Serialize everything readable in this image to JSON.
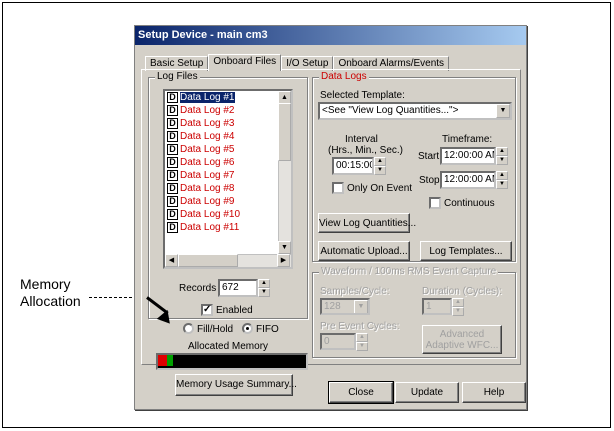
{
  "callout": {
    "line1": "Memory",
    "line2": "Allocation"
  },
  "dialog": {
    "title": "Setup Device - main cm3",
    "tabs": [
      "Basic Setup",
      "Onboard Files",
      "I/O Setup",
      "Onboard Alarms/Events"
    ],
    "active_tab": "Onboard Files"
  },
  "log_files": {
    "group_label": "Log Files",
    "items": [
      {
        "icon": "D",
        "label": "Data Log #1",
        "selected": true
      },
      {
        "icon": "D",
        "label": "Data Log #2"
      },
      {
        "icon": "D",
        "label": "Data Log #3"
      },
      {
        "icon": "D",
        "label": "Data Log #4"
      },
      {
        "icon": "D",
        "label": "Data Log #5"
      },
      {
        "icon": "D",
        "label": "Data Log #6"
      },
      {
        "icon": "D",
        "label": "Data Log #7"
      },
      {
        "icon": "D",
        "label": "Data Log #8"
      },
      {
        "icon": "D",
        "label": "Data Log #9"
      },
      {
        "icon": "D",
        "label": "Data Log #10"
      },
      {
        "icon": "D",
        "label": "Data Log #11"
      }
    ],
    "records_label": "Records",
    "records_value": "672",
    "enabled_label": "Enabled",
    "enabled_checked": true,
    "fill_hold_label": "Fill/Hold",
    "fifo_label": "FIFO",
    "mode_selected": "FIFO",
    "allocated_label": "Allocated Memory",
    "memory_summary_label": "Memory Usage Summary..."
  },
  "data_logs": {
    "group_label": "Data Logs",
    "selected_template_label": "Selected Template:",
    "selected_template_value": "<See \"View Log Quantities...\">",
    "interval_label": "Interval",
    "interval_sub": "(Hrs., Min., Sec.)",
    "interval_value": "00:15:00",
    "only_on_event_label": "Only On Event",
    "timeframe_label": "Timeframe:",
    "start_label": "Start:",
    "start_value": "12:00:00 AM",
    "stop_label": "Stop:",
    "stop_value": "12:00:00 AM",
    "continuous_label": "Continuous",
    "view_log_quantities_label": "View Log Quantities...",
    "automatic_upload_label": "Automatic Upload...",
    "log_templates_label": "Log Templates..."
  },
  "waveform": {
    "group_label": "Waveform / 100ms RMS Event Capture",
    "samples_label": "Samples/Cycle:",
    "samples_value": "128",
    "duration_label": "Duration (Cycles):",
    "duration_value": "1",
    "pre_event_label": "Pre Event Cycles:",
    "pre_event_value": "0",
    "advanced_label_1": "Advanced",
    "advanced_label_2": "Adaptive WFC..."
  },
  "footer": {
    "close_label": "Close",
    "update_label": "Update",
    "help_label": "Help"
  },
  "colors": {
    "title_start": "#0a246a",
    "title_end": "#a6caf0",
    "group_text": "#cc0000",
    "mem_used": "#e00000",
    "mem_marker": "#00a000",
    "mem_bg": "#000000"
  }
}
